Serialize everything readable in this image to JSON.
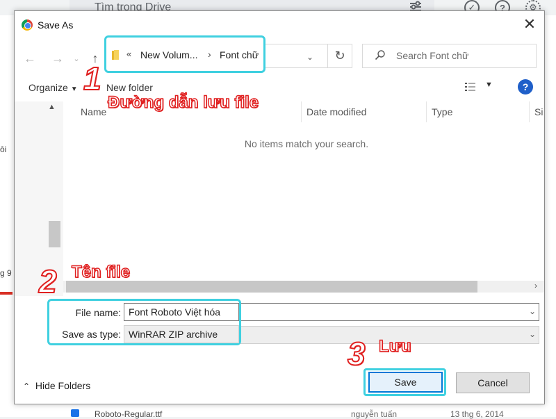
{
  "background": {
    "search_placeholder": "Tìm trong Drive",
    "left_text_1": "ôi",
    "left_text_2": "g 9",
    "file_name": "Roboto-Regular.ttf",
    "file_owner": "nguyễn tuấn",
    "file_date": "13 thg 6, 2014"
  },
  "dialog": {
    "title": "Save As",
    "address": {
      "overflow": "«",
      "segment1": "New Volum...",
      "separator": "›",
      "segment2": "Font chữ"
    },
    "search_placeholder": "Search Font chữ",
    "toolbar": {
      "organize": "Organize",
      "new_folder": "New folder"
    },
    "columns": [
      "Name",
      "Date modified",
      "Type",
      "Si"
    ],
    "empty_message": "No items match your search.",
    "file_name_label": "File name:",
    "file_name_value": "Font Roboto Việt hóa",
    "save_type_label": "Save as type:",
    "save_type_value": "WinRAR ZIP archive",
    "hide_folders": "Hide Folders",
    "save_label": "Save",
    "cancel_label": "Cancel"
  },
  "annotations": [
    {
      "number": "1",
      "text": "Đường dẫn lưu file"
    },
    {
      "number": "2",
      "text": "Tên file"
    },
    {
      "number": "3",
      "text": "Lưu"
    }
  ],
  "colors": {
    "highlight": "#3fd0e0",
    "annotation_stroke": "#e02020",
    "save_border": "#0078d7",
    "help_blue": "#1f5fc9"
  }
}
